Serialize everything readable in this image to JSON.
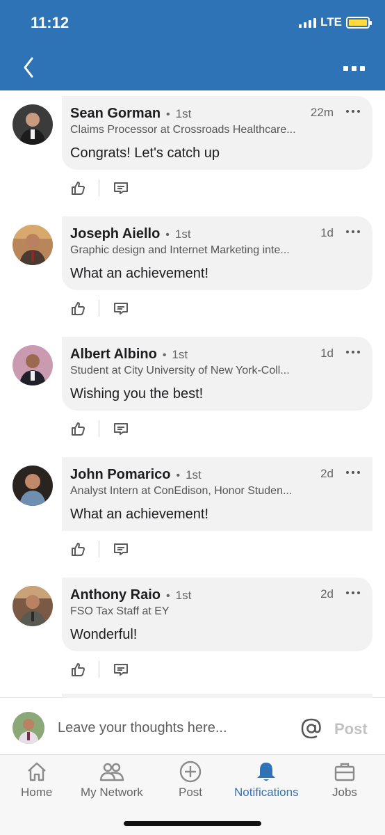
{
  "status_bar": {
    "time": "11:12",
    "network": "LTE"
  },
  "comments": [
    {
      "name": "Sean Gorman",
      "degree": "1st",
      "time": "22m",
      "headline": "Claims Processor at Crossroads Healthcare...",
      "text": "Congrats! Let's catch up"
    },
    {
      "name": "Joseph Aiello",
      "degree": "1st",
      "time": "1d",
      "headline": "Graphic design and Internet Marketing inte...",
      "text": "What an achievement!"
    },
    {
      "name": "Albert Albino",
      "degree": "1st",
      "time": "1d",
      "headline": "Student at City University of New York-Coll...",
      "text": "Wishing you the best!"
    },
    {
      "name": "John Pomarico",
      "degree": "1st",
      "time": "2d",
      "headline": "Analyst Intern at ConEdison, Honor Studen...",
      "text": "What an achievement!"
    },
    {
      "name": "Anthony Raio",
      "degree": "1st",
      "time": "2d",
      "headline": "FSO Tax Staff at EY",
      "text": "Wonderful!"
    }
  ],
  "compose": {
    "placeholder": "Leave your thoughts here...",
    "post_label": "Post"
  },
  "tabs": [
    {
      "label": "Home",
      "icon": "home-icon"
    },
    {
      "label": "My Network",
      "icon": "network-icon"
    },
    {
      "label": "Post",
      "icon": "plus-circle-icon"
    },
    {
      "label": "Notifications",
      "icon": "bell-icon",
      "active": true
    },
    {
      "label": "Jobs",
      "icon": "briefcase-icon"
    }
  ],
  "colors": {
    "header": "#2f73b7",
    "accent": "#2f73b7",
    "bubble": "#f2f2f3"
  }
}
